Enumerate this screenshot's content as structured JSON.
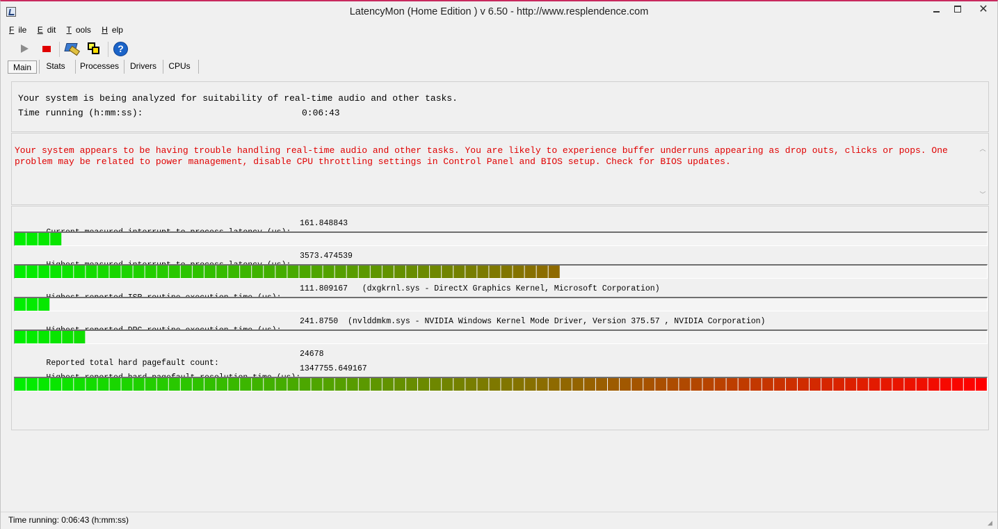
{
  "window": {
    "title": "LatencyMon  (Home Edition )  v 6.50 - http://www.resplendence.com",
    "close_glyph": "✕"
  },
  "menu": [
    {
      "label": "File",
      "accel": "F",
      "rest": "ile"
    },
    {
      "label": "Edit",
      "accel": "E",
      "rest": "dit"
    },
    {
      "label": "Tools",
      "accel": "T",
      "rest": "ools"
    },
    {
      "label": "Help",
      "accel": "H",
      "rest": "elp"
    }
  ],
  "toolbar": {
    "icons": [
      "play-icon",
      "stop-icon",
      "analyze-tool-icon",
      "windows-icon",
      "help-icon"
    ],
    "help_glyph": "?"
  },
  "tabs": [
    {
      "label": "Main",
      "active": true
    },
    {
      "label": "Stats",
      "active": false
    },
    {
      "label": "Processes",
      "active": false
    },
    {
      "label": "Drivers",
      "active": false
    },
    {
      "label": "CPUs",
      "active": false
    }
  ],
  "summary": {
    "analyzing_text": "Your system is being analyzed for suitability of real-time audio and other tasks.",
    "time_label": "Time running (h:mm:ss):",
    "time_value": "0:06:43"
  },
  "warning": {
    "line1": "Your system appears to be having trouble handling real-time audio and other tasks. You are likely to experience buffer underruns appearing as drop outs, clicks or pops. One",
    "line2": "problem may be related to power management, disable CPU throttling settings in Control Panel and BIOS setup. Check for BIOS updates.",
    "color": "#e00000",
    "scroll_up": "︿",
    "scroll_down": "﹀"
  },
  "metrics": {
    "current_latency": {
      "label": "Current measured interrupt to process latency (µs):",
      "value": "161.848843",
      "segments_filled": 4
    },
    "highest_latency": {
      "label": "Highest measured interrupt to process latency (µs):",
      "value": "3573.474539",
      "segments_filled": 46
    },
    "isr": {
      "label": "Highest reported ISR routine execution time (µs):",
      "value": "111.809167",
      "detail": "(dxgkrnl.sys - DirectX Graphics Kernel, Microsoft Corporation)",
      "segments_filled": 3
    },
    "dpc": {
      "label": "Highest reported DPC routine execution time (µs):",
      "value": "241.8750",
      "detail": "(nvlddmkm.sys - NVIDIA Windows Kernel Mode Driver, Version 375.57 , NVIDIA Corporation)",
      "segments_filled": 6
    },
    "pagefault_count": {
      "label": "Reported total hard pagefault count:",
      "value": "24678"
    },
    "pagefault_time": {
      "label": "Highest reported hard pagefault resolution time (µs):",
      "value": "1347755.649167",
      "segments_filled": 82
    }
  },
  "bar_colors": {
    "start": "#00ee00",
    "end": "#ff0000",
    "total_segments": 82
  },
  "statusbar": {
    "text": "Time running: 0:06:43  (h:mm:ss)",
    "grip_glyph": "◢"
  }
}
